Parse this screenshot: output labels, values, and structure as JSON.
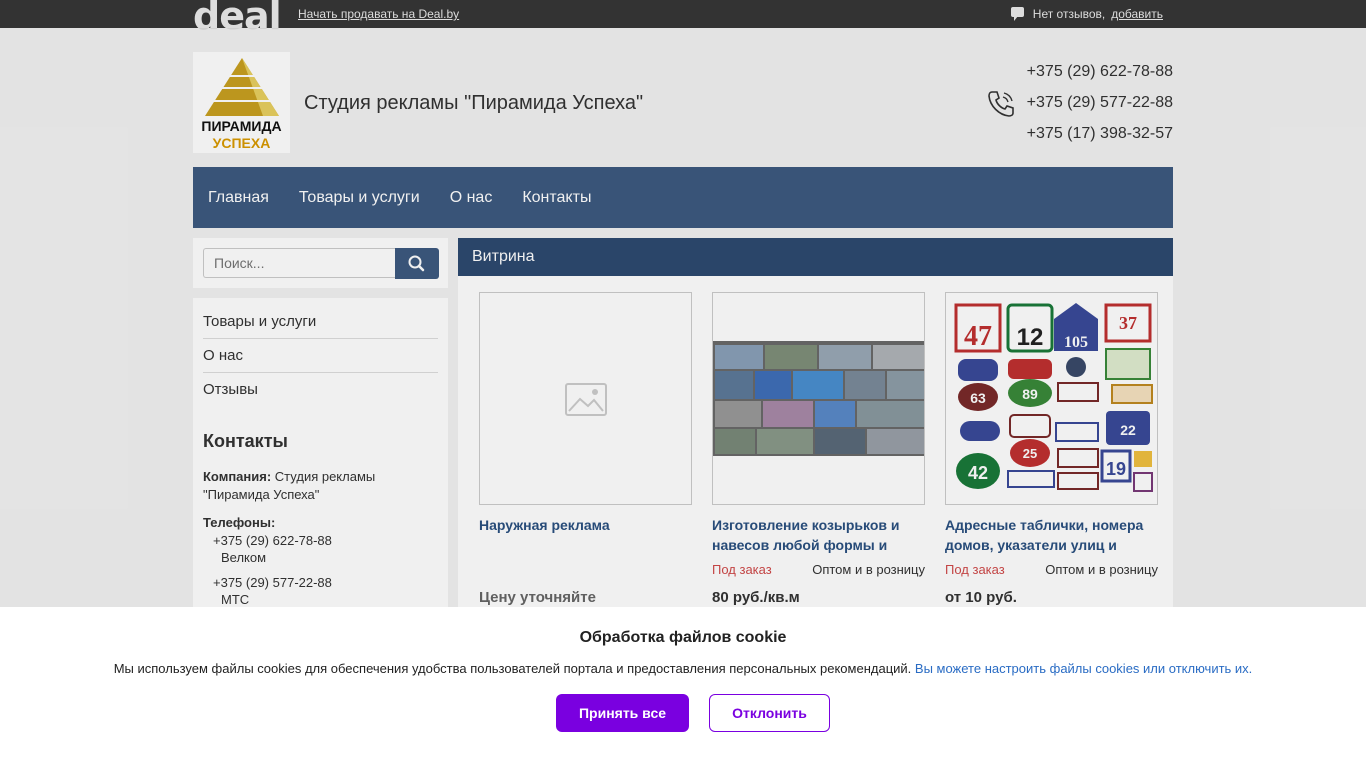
{
  "topbar": {
    "logo": "deal",
    "sell_link": "Начать продавать на Deal.by",
    "reviews_text": "Нет отзывов,",
    "reviews_add": "добавить"
  },
  "header": {
    "logo_line1": "ПИРАМИДА",
    "logo_line2": "УСПЕХА",
    "company_name": "Студия рекламы \"Пирамида Успеха\"",
    "phones": [
      "+375 (29) 622-78-88",
      "+375 (29) 577-22-88",
      "+375 (17) 398-32-57"
    ]
  },
  "nav": {
    "items": [
      "Главная",
      "Товары и услуги",
      "О нас",
      "Контакты"
    ]
  },
  "search": {
    "placeholder": "Поиск..."
  },
  "sidebar": {
    "menu": [
      "Товары и услуги",
      "О нас",
      "Отзывы"
    ],
    "contacts_title": "Контакты",
    "company_label": "Компания:",
    "company_value": "Студия рекламы \"Пирамида Успеха\"",
    "phones_label": "Телефоны:",
    "phone_entries": [
      {
        "number": "+375 (29) 622-78-88",
        "operator": "Велком"
      },
      {
        "number": "+375 (29) 577-22-88",
        "operator": "МТС"
      }
    ]
  },
  "main": {
    "section_title": "Витрина",
    "cards": [
      {
        "title": "Наружная реклама",
        "order": "",
        "sale": "",
        "price": "Цену уточняйте"
      },
      {
        "title": "Изготовление козырьков и навесов любой формы и",
        "order": "Под заказ",
        "sale": "Оптом и в розницу",
        "price": "80 руб./кв.м"
      },
      {
        "title": "Адресные таблички, номера домов, указатели улиц и",
        "order": "Под заказ",
        "sale": "Оптом и в розницу",
        "price": "от 10 руб."
      }
    ]
  },
  "cookie": {
    "title": "Обработка файлов cookie",
    "text": "Мы используем файлы cookies для обеспечения удобства пользователей портала и предоставления персональных рекомендаций.",
    "link": "Вы можете настроить файлы cookies или отключить их.",
    "accept": "Принять все",
    "decline": "Отклонить"
  },
  "colors": {
    "nav_bg": "#3d5a80",
    "accent_purple": "#7a00e0",
    "link_blue": "#2a5080",
    "order_red": "#d04a4a"
  }
}
